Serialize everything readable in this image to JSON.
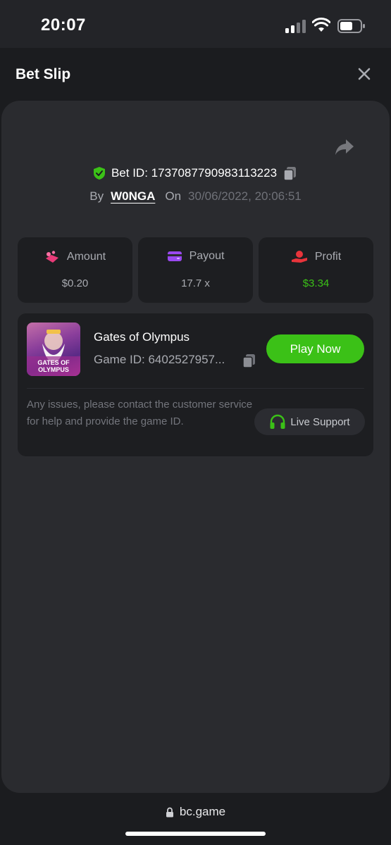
{
  "status_bar": {
    "time": "20:07"
  },
  "header": {
    "title": "Bet Slip"
  },
  "bet": {
    "bet_id": "Bet ID: 1737087790983113223",
    "by_label": "By",
    "username": "W0NGA",
    "on_label": "On",
    "datetime": "30/06/2022, 20:06:51"
  },
  "stats": [
    {
      "label": "Amount",
      "value": "$0.20",
      "icon": "coins-icon"
    },
    {
      "label": "Payout",
      "value": "17.7 x",
      "icon": "wallet-icon"
    },
    {
      "label": "Profit",
      "value": "$3.34",
      "icon": "hand-coin-icon"
    }
  ],
  "game": {
    "name": "Gates of Olympus",
    "game_id": "Game ID: 6402527957...",
    "thumb_text": "GATES OF OLYMPUS",
    "play_label": "Play Now",
    "support_text": "Any issues, please contact the customer service for help and provide the game ID.",
    "support_label": "Live Support"
  },
  "browser": {
    "url": "bc.game"
  },
  "colors": {
    "accent_green": "#3bc117",
    "background": "#232428",
    "card": "#2a2b2f",
    "profit": "#3bc117"
  }
}
